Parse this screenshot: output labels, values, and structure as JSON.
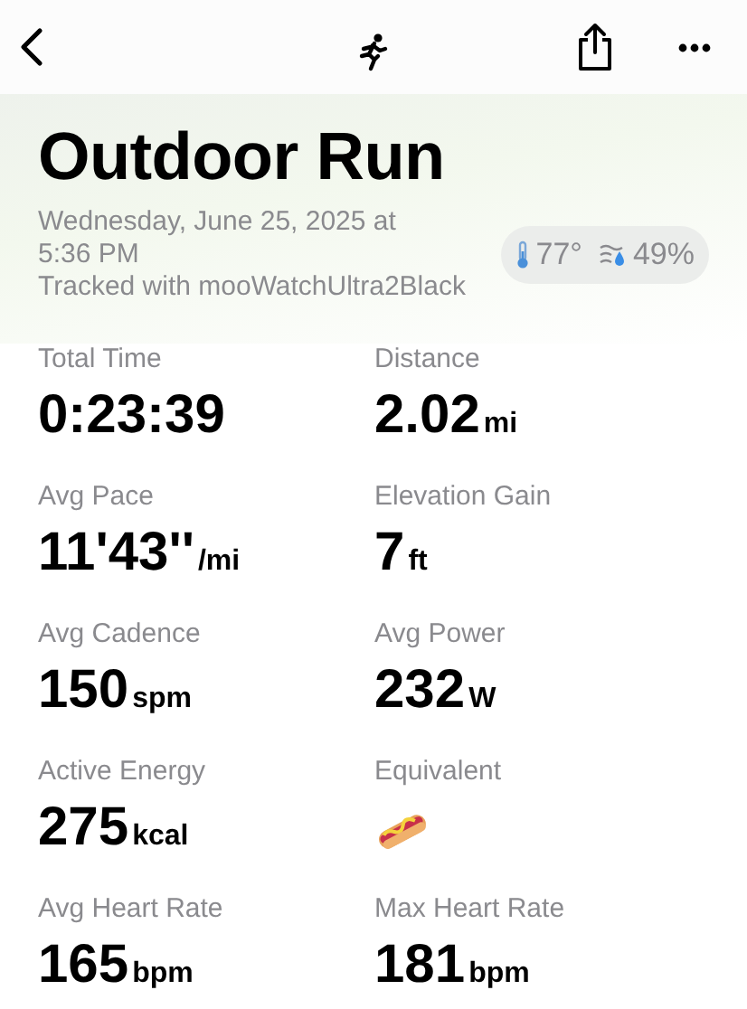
{
  "title": "Outdoor Run",
  "date_line_1": "Wednesday, June 25, 2025 at",
  "date_line_2": "5:36 PM",
  "tracked_with": "Tracked with mooWatchUltra2Black",
  "weather": {
    "temperature": "77°",
    "humidity": "49%"
  },
  "metrics": [
    {
      "kind": "value",
      "label": "Total Time",
      "value": "0:23:39"
    },
    {
      "kind": "value",
      "label": "Distance",
      "value": "2.02",
      "unit": "mi"
    },
    {
      "kind": "value",
      "label": "Avg Pace",
      "value": "11'43''",
      "unit": "/mi"
    },
    {
      "kind": "value",
      "label": "Elevation Gain",
      "value": "7",
      "unit": "ft"
    },
    {
      "kind": "value",
      "label": "Avg Cadence",
      "value": "150",
      "unit": "spm"
    },
    {
      "kind": "value",
      "label": "Avg Power",
      "value": "232",
      "unit": "W"
    },
    {
      "kind": "value",
      "label": "Active Energy",
      "value": "275",
      "unit": "kcal"
    },
    {
      "kind": "icon",
      "label": "Equivalent"
    },
    {
      "kind": "value",
      "label": "Avg Heart Rate",
      "value": "165",
      "unit": "bpm"
    },
    {
      "kind": "value",
      "label": "Max Heart Rate",
      "value": "181",
      "unit": "bpm"
    }
  ]
}
